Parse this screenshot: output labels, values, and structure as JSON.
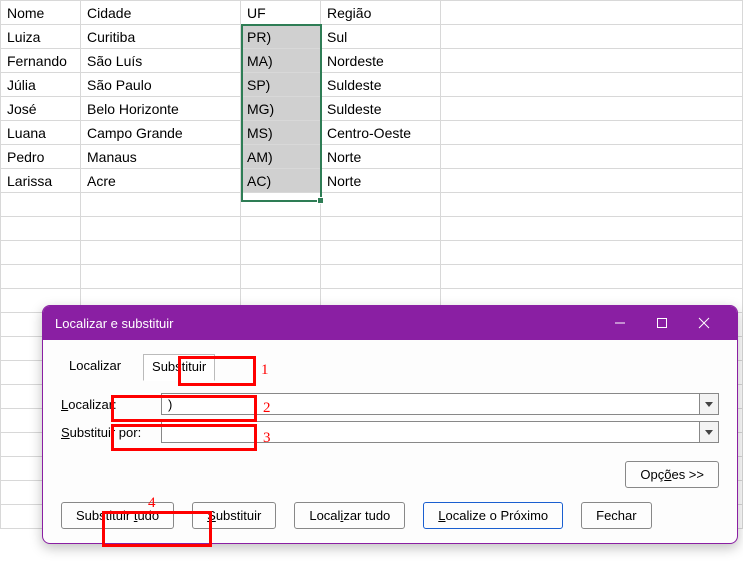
{
  "sheet": {
    "headers": {
      "a": "Nome",
      "b": "Cidade",
      "c": "UF",
      "d": "Região"
    },
    "rows": [
      {
        "a": "Luiza",
        "b": "Curitiba",
        "c": "PR)",
        "d": "Sul"
      },
      {
        "a": "Fernando",
        "b": "São Luís",
        "c": "MA)",
        "d": "Nordeste"
      },
      {
        "a": "Júlia",
        "b": "São Paulo",
        "c": "SP)",
        "d": "Suldeste"
      },
      {
        "a": "José",
        "b": "Belo Horizonte",
        "c": "MG)",
        "d": "Suldeste"
      },
      {
        "a": "Luana",
        "b": "Campo Grande",
        "c": "MS)",
        "d": "Centro-Oeste"
      },
      {
        "a": "Pedro",
        "b": "Manaus",
        "c": "AM)",
        "d": "Norte"
      },
      {
        "a": "Larissa",
        "b": "Acre",
        "c": "AC)",
        "d": "Norte"
      }
    ]
  },
  "dialog": {
    "title": "Localizar e substituir",
    "tabs": {
      "find": "Localizar",
      "replace": "Substituir"
    },
    "labels": {
      "find": "Localizar:",
      "replace": "Substituir por:"
    },
    "values": {
      "find": ")",
      "replace": ""
    },
    "options_btn": "Opções >>",
    "buttons": {
      "replace_all": "Substituir tudo",
      "replace": "Substituir",
      "find_all": "Localizar tudo",
      "find_next": "Localize o Próximo",
      "close": "Fechar"
    }
  },
  "annotations": {
    "n1": "1",
    "n2": "2",
    "n3": "3",
    "n4": "4"
  }
}
